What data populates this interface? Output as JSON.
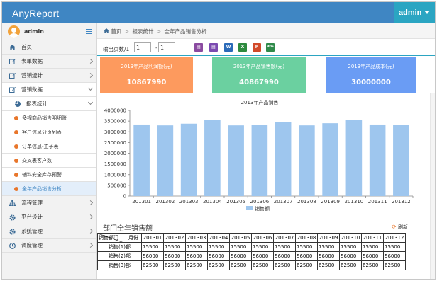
{
  "app": {
    "brand": "AnyReport",
    "user_menu": "admin"
  },
  "sidebar": {
    "user": "admin",
    "items": [
      {
        "label": "首页",
        "icon": "home-icon"
      },
      {
        "label": "表单数据",
        "icon": "edit-icon"
      },
      {
        "label": "营销统计",
        "icon": "edit-icon"
      },
      {
        "label": "营销数据",
        "icon": "edit-icon"
      },
      {
        "label": "报表统计",
        "icon": "pie-chart-icon"
      },
      {
        "label": "多视商品销售明细账",
        "icon": "pie-chart-icon"
      },
      {
        "label": "客户信息分页列表",
        "icon": "pie-chart-icon"
      },
      {
        "label": "订单信息-主子表",
        "icon": "pie-chart-icon"
      },
      {
        "label": "交叉表客户数",
        "icon": "pie-chart-icon"
      },
      {
        "label": "辅料安全库存预警",
        "icon": "pie-chart-icon"
      },
      {
        "label": "全年产品销售分析",
        "icon": "pie-chart-icon"
      },
      {
        "label": "流程管理",
        "icon": "sitemap-icon"
      },
      {
        "label": "平台设计",
        "icon": "gear-icon"
      },
      {
        "label": "系统管理",
        "icon": "gear-icon"
      },
      {
        "label": "调度管理",
        "icon": "clock-icon"
      }
    ]
  },
  "breadcrumb": [
    "首页",
    "报表统计",
    "全年产品销售分析"
  ],
  "toolbar": {
    "pages_label": "输出页数/1",
    "page_from": "1",
    "page_to": "1",
    "dash": "-",
    "pdf_label": "PDF"
  },
  "colors": {
    "topbar": "#3f86c3",
    "user_menu": "#2ba5c2",
    "card_profit": "#fd9a5e",
    "card_sales": "#6bd0a0",
    "card_cost": "#6a9cf4",
    "bar": "#9ec6ee"
  },
  "cards": [
    {
      "label": "2013年产品利润额(元)",
      "value": "10867990"
    },
    {
      "label": "2013年产品销售额(元)",
      "value": "40867990"
    },
    {
      "label": "2013年产品成本(元)",
      "value": "30000000"
    }
  ],
  "chart_data": {
    "type": "bar",
    "title": "2013年产品销售",
    "categories": [
      "201301",
      "201302",
      "201303",
      "201304",
      "201305",
      "201306",
      "201307",
      "201308",
      "201309",
      "201310",
      "201311",
      "201312"
    ],
    "series": [
      {
        "name": "销售额",
        "values": [
          3340000,
          3300000,
          3380000,
          3540000,
          3300000,
          3320000,
          3460000,
          3300000,
          3400000,
          3540000,
          3340000,
          3320000
        ]
      }
    ],
    "ylim": [
      0,
      4000000
    ],
    "yticks": [
      "0",
      "500000",
      "1000000",
      "1500000",
      "2000000",
      "2500000",
      "3000000",
      "3500000",
      "4000000"
    ],
    "legend": "bottom",
    "grid": false
  },
  "table": {
    "title": "部门全年销售额",
    "refresh": "刷新",
    "corner_top": "月份",
    "corner_bottom": "销售部门",
    "months": [
      "201301",
      "201302",
      "201303",
      "201304",
      "201305",
      "201306",
      "201307",
      "201308",
      "201309",
      "201310",
      "201311",
      "201312"
    ],
    "rows": [
      {
        "dept": "销售(1)部",
        "values": [
          "75500",
          "75500",
          "75500",
          "75500",
          "75500",
          "75500",
          "75500",
          "75500",
          "75500",
          "75500",
          "75500",
          "75500"
        ]
      },
      {
        "dept": "销售(2)部",
        "values": [
          "56000",
          "56000",
          "56000",
          "56000",
          "56000",
          "56000",
          "56000",
          "56000",
          "56000",
          "56000",
          "56000",
          "56000"
        ]
      },
      {
        "dept": "销售(3)部",
        "values": [
          "62500",
          "62500",
          "62500",
          "62500",
          "62500",
          "62500",
          "62500",
          "62500",
          "62500",
          "62500",
          "62500",
          "62500"
        ]
      }
    ]
  }
}
